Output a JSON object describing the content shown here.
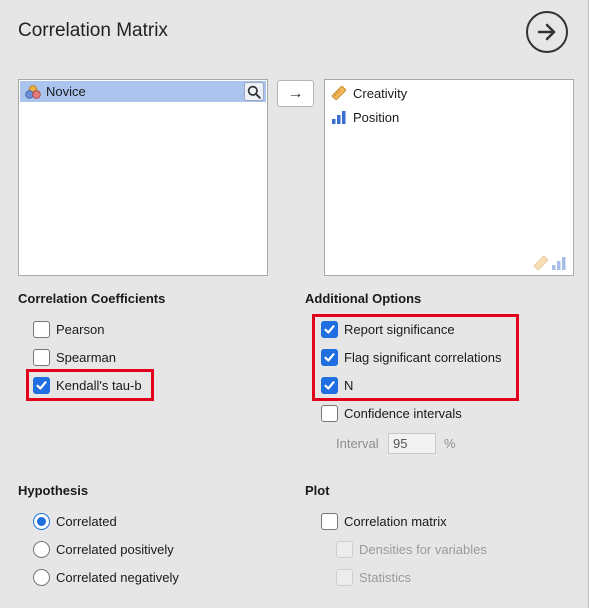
{
  "panel": {
    "title": "Correlation Matrix"
  },
  "available": {
    "items": [
      {
        "label": "Novice",
        "icon": "nominal-variable-icon"
      }
    ]
  },
  "move_button": {
    "label": "→"
  },
  "target": {
    "items": [
      {
        "label": "Creativity",
        "icon": "ordinal-variable-icon"
      },
      {
        "label": "Position",
        "icon": "scale-variable-icon"
      }
    ]
  },
  "coefficients": {
    "title": "Correlation Coefficients",
    "options": [
      {
        "label": "Pearson",
        "checked": false
      },
      {
        "label": "Spearman",
        "checked": false
      },
      {
        "label": "Kendall's tau-b",
        "checked": true
      }
    ]
  },
  "additional": {
    "title": "Additional Options",
    "options": [
      {
        "label": "Report significance",
        "checked": true
      },
      {
        "label": "Flag significant correlations",
        "checked": true
      },
      {
        "label": "N",
        "checked": true
      },
      {
        "label": "Confidence intervals",
        "checked": false
      }
    ],
    "interval_label": "Interval",
    "interval_value": "95",
    "interval_unit": "%"
  },
  "hypothesis": {
    "title": "Hypothesis",
    "options": [
      {
        "label": "Correlated",
        "selected": true
      },
      {
        "label": "Correlated positively",
        "selected": false
      },
      {
        "label": "Correlated negatively",
        "selected": false
      }
    ]
  },
  "plot": {
    "title": "Plot",
    "options": [
      {
        "label": "Correlation matrix",
        "checked": false,
        "enabled": true
      },
      {
        "label": "Densities for variables",
        "checked": false,
        "enabled": false
      },
      {
        "label": "Statistics",
        "checked": false,
        "enabled": false
      }
    ]
  },
  "colors": {
    "accent": "#1f6fe0",
    "highlight": "#e3001b",
    "selection": "#aac4ee"
  }
}
